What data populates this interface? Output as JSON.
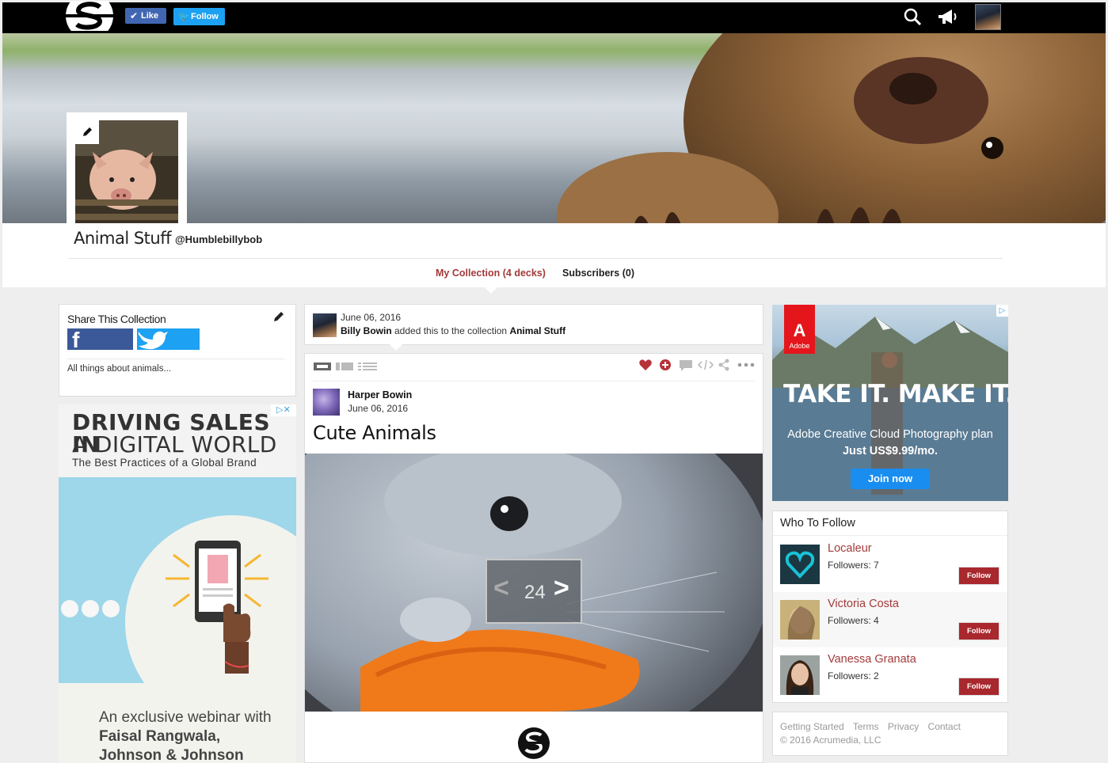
{
  "nav": {
    "like_label": "Like",
    "follow_label": "Follow"
  },
  "collection": {
    "title": "Animal Stuff",
    "handle": "@Humblebillybob"
  },
  "tabs": [
    {
      "label": "My Collection (4 decks)",
      "active": true
    },
    {
      "label": "Subscribers (0)",
      "active": false
    }
  ],
  "share": {
    "title": "Share This Collection",
    "description": "All things about animals..."
  },
  "ad_left": {
    "headline_1": "DRIVING SALES IN",
    "headline_2": "A DIGITAL WORLD",
    "subheadline": "The Best Practices of a Global Brand",
    "body_1": "An exclusive webinar with",
    "body_2": "Faisal Rangwala,",
    "body_3": "Johnson & Johnson"
  },
  "activity": {
    "date": "June 06, 2016",
    "actor": "Billy Bowin",
    "action_text": " added this to the collection ",
    "collection": "Animal Stuff"
  },
  "deck": {
    "author": "Harper Bowin",
    "date": "June 06, 2016",
    "title": "Cute Animals",
    "pager": {
      "prev": "<",
      "current": "24",
      "next": ">"
    }
  },
  "ad_right": {
    "brand": "Adobe",
    "headline": "TAKE IT. MAKE IT.",
    "line_1": "Adobe Creative Cloud Photography plan",
    "line_2": "Just US$9.99/mo.",
    "cta": "Join now"
  },
  "who_to_follow": {
    "title": "Who To Follow",
    "users": [
      {
        "name": "Localeur",
        "followers": "Followers: 7",
        "button": "Follow"
      },
      {
        "name": "Victoria Costa",
        "followers": "Followers: 4",
        "button": "Follow"
      },
      {
        "name": "Vanessa Granata",
        "followers": "Followers: 2",
        "button": "Follow"
      }
    ]
  },
  "footer": {
    "links": [
      "Getting Started",
      "Terms",
      "Privacy",
      "Contact"
    ],
    "copyright": "© 2016 Acrumedia, LLC"
  },
  "colors": {
    "accent_red": "#a33a3a",
    "facebook": "#3b5998",
    "twitter": "#1da1f2",
    "follow_button": "#a8282e"
  }
}
